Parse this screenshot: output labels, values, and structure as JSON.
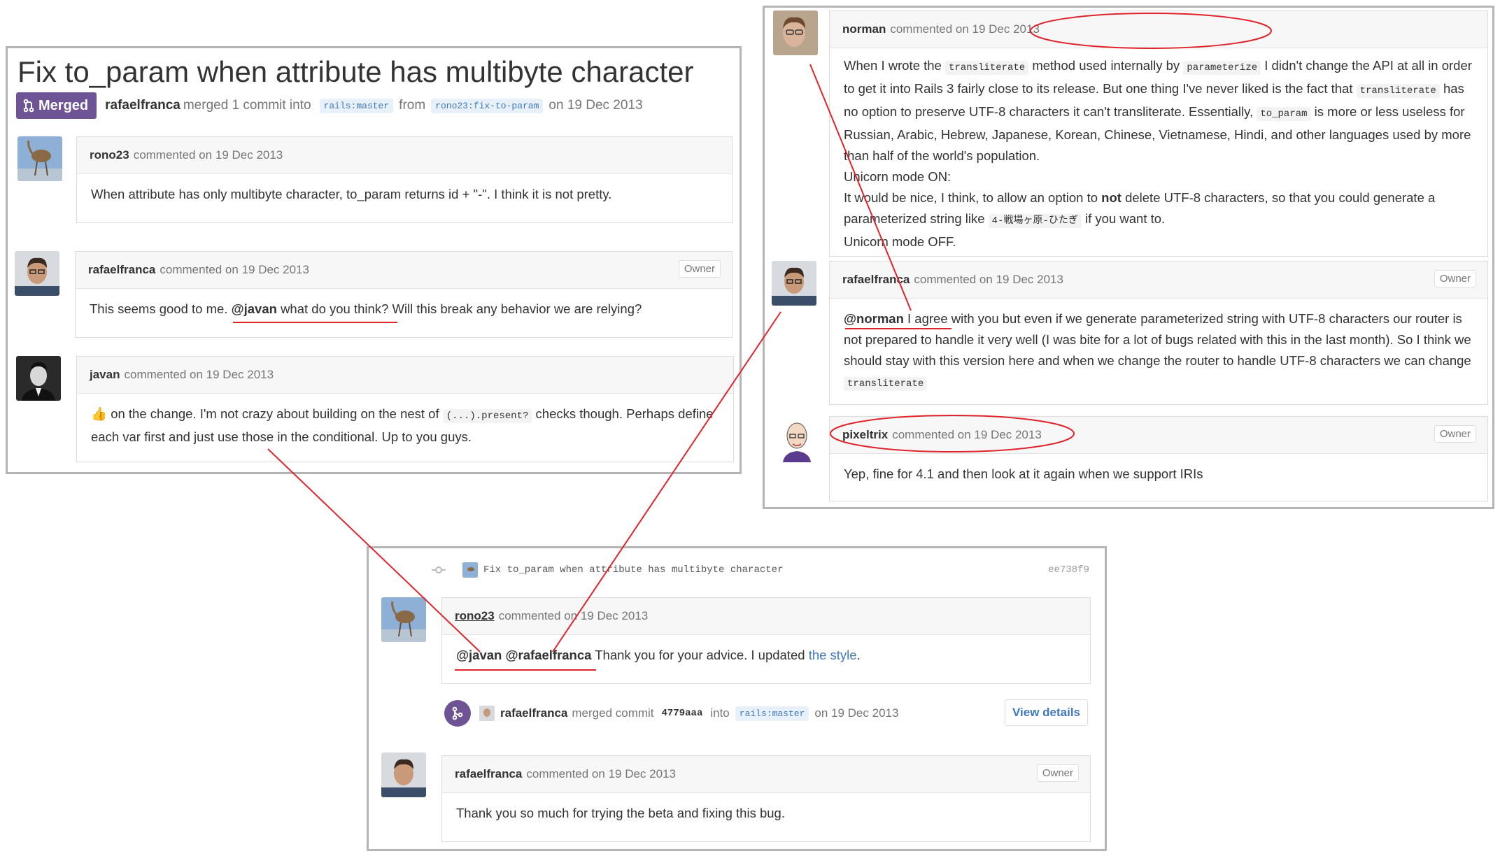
{
  "left_panel": {
    "title": "Fix to_param when attribute has multibyte character",
    "merged_label": "Merged",
    "meta_author": "rafaelfranca",
    "meta_text": "merged 1 commit into",
    "base_branch": "rails:master",
    "from_word": "from",
    "head_branch": "rono23:fix-to-param",
    "date_text": "on 19 Dec 2013",
    "comments": [
      {
        "author": "rono23",
        "meta": "commented on 19 Dec 2013",
        "body": "When attribute has only multibyte character, to_param returns id + \"-\". I think it is not pretty."
      },
      {
        "author": "rafaelfranca",
        "meta": "commented on 19 Dec 2013",
        "badge": "Owner",
        "body_prefix": "This seems good to me.",
        "mention": "@javan",
        "body_suffix": "what do you think? Will this break any behavior we are relying?"
      },
      {
        "author": "javan",
        "meta": "commented on 19 Dec 2013",
        "emoji": "👍",
        "body_a": "on the change. I'm not crazy about building on the nest of",
        "code": "(...).present?",
        "body_b": "checks though. Perhaps define each var first and just use those in the conditional. Up to you guys."
      }
    ]
  },
  "right_panel": {
    "comments": [
      {
        "author": "norman",
        "meta": "commented on 19 Dec 2013",
        "p1_a": "When I wrote the",
        "code1": "transliterate",
        "p1_b": "method used internally by",
        "code2": "parameterize",
        "p1_c": "I didn't change the API at all in order to get it into Rails 3 fairly close to its release. But one thing I've never liked is the fact that",
        "code3": "transliterate",
        "p1_d": "has no option to preserve UTF-8 characters it can't transliterate. Essentially,",
        "code4": "to_param",
        "p1_e": "is more or less useless for Russian, Arabic, Hebrew, Japanese, Korean, Chinese, Vietnamese, Hindi, and other languages used by more than half of the world's population.",
        "p2": "Unicorn mode ON:",
        "p3_a": "It would be nice, I think, to allow an option to",
        "p3_bold": "not",
        "p3_b": "delete UTF-8 characters, so that you could generate a parameterized string like",
        "code5": "4-戦場ヶ原-ひたぎ",
        "p3_c": "if you want to.",
        "p4": "Unicorn mode OFF."
      },
      {
        "author": "rafaelfranca",
        "meta": "commented on 19 Dec 2013",
        "badge": "Owner",
        "mention": "@norman",
        "body_a": "I agree with you but even if we generate parameterized string with UTF-8 characters our router is not prepared to handle it very well (I was bite for a lot of bugs related with this in the last month). So I think we should stay with this version here and when we change the router to handle UTF-8 characters we can change",
        "code": "transliterate"
      },
      {
        "author": "pixeltrix",
        "meta": "commented on 19 Dec 2013",
        "badge": "Owner",
        "body": "Yep, fine for 4.1 and then look at it again when we support IRIs"
      }
    ]
  },
  "bottom_panel": {
    "commit_message": "Fix to_param when attribute has multibyte character",
    "commit_sha": "ee738f9",
    "comment1": {
      "author": "rono23",
      "meta": "commented on 19 Dec 2013",
      "mention1": "@javan",
      "mention2": "@rafaelfranca",
      "body": "Thank you for your advice. I updated",
      "link": "the style",
      "end": "."
    },
    "merge_event": {
      "author": "rafaelfranca",
      "text": "merged commit",
      "sha": "4779aaa",
      "into": "into",
      "branch": "rails:master",
      "date": "on 19 Dec 2013",
      "button": "View details"
    },
    "comment2": {
      "author": "rafaelfranca",
      "meta": "commented on 19 Dec 2013",
      "badge": "Owner",
      "body": "Thank you so much for trying the beta and fixing this bug."
    }
  },
  "annotation_color": "#e0242c",
  "colors": {
    "merged": "#6e5494",
    "link": "#4078c0"
  },
  "icons": [
    "git-pull-request-icon",
    "git-merge-icon",
    "git-commit-icon",
    "thumbs-up-icon"
  ]
}
